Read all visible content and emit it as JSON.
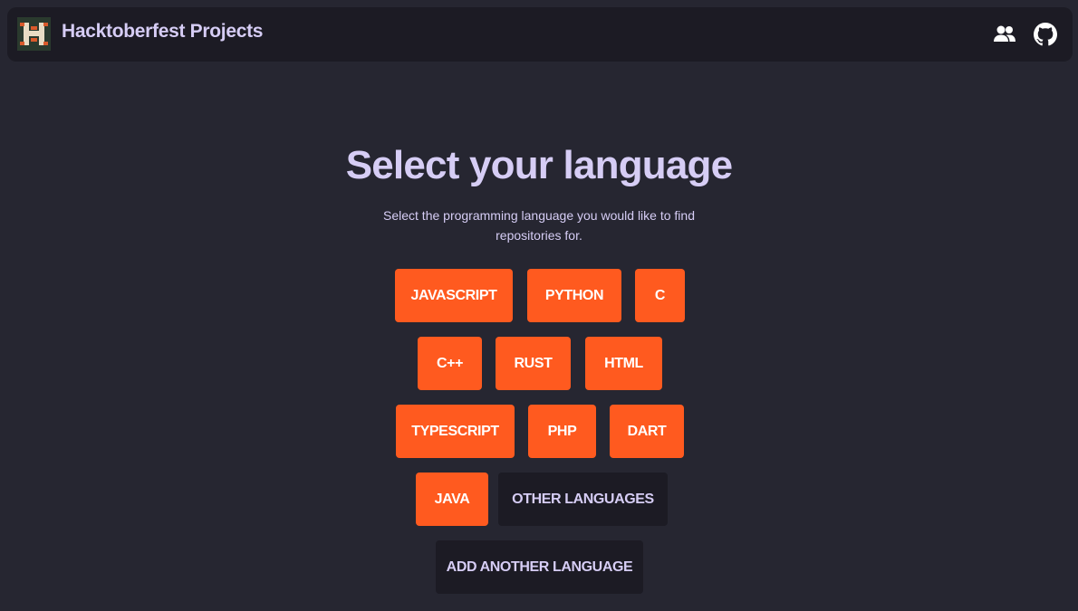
{
  "header": {
    "brand": "Hacktoberfest Projects",
    "logo_icon": "hacktoberfest-logo-icon",
    "contributors_icon": "users-icon",
    "github_icon": "github-icon"
  },
  "main": {
    "title": "Select your language",
    "subtitle": "Select the programming language you would like to find repositories for."
  },
  "languages": [
    "JAVASCRIPT",
    "PYTHON",
    "C",
    "C++",
    "RUST",
    "HTML",
    "TYPESCRIPT",
    "PHP",
    "DART",
    "JAVA"
  ],
  "other_languages_label": "OTHER LANGUAGES",
  "add_language_label": "ADD ANOTHER LANGUAGE",
  "colors": {
    "accent": "#ff5a1f",
    "background": "#262631",
    "surface": "#1c1b24",
    "text": "#d6cdf5"
  }
}
